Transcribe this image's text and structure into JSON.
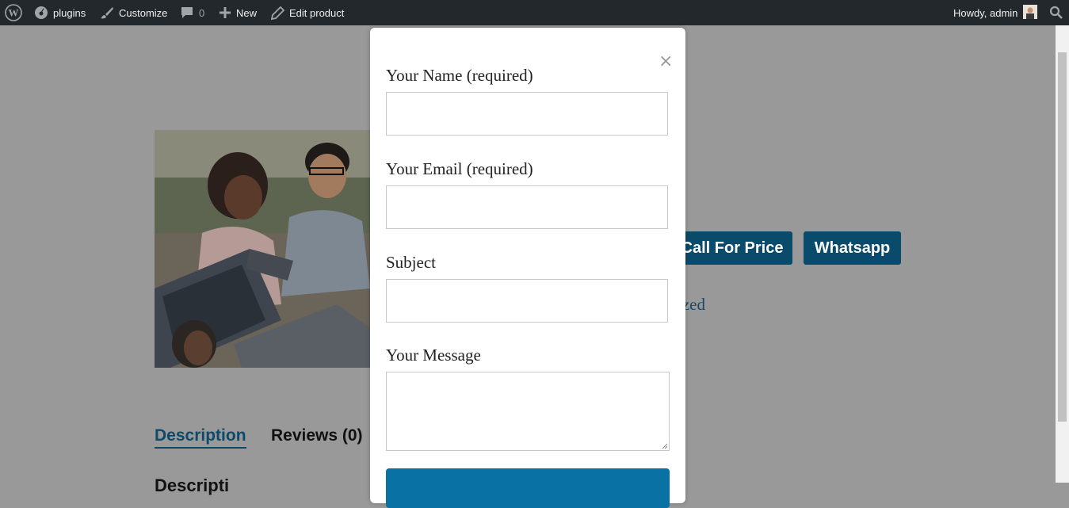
{
  "adminbar": {
    "site_name": "plugins",
    "customize": "Customize",
    "comments_count": "0",
    "new": "New",
    "edit_product": "Edit product",
    "howdy": "Howdy, admin"
  },
  "product": {
    "buttons": {
      "call_for_price": "Call For Price",
      "whatsapp": "Whatsapp"
    },
    "category_fragment": "rized",
    "tabs": {
      "description": "Description",
      "reviews": "Reviews (0)"
    },
    "description_heading": "Descripti"
  },
  "modal": {
    "fields": {
      "name_label": "Your Name (required)",
      "email_label": "Your Email (required)",
      "subject_label": "Subject",
      "message_label": "Your Message"
    }
  },
  "colors": {
    "adminbar_bg": "#23282d",
    "overlay": "#999999",
    "accent": "#0a71a5",
    "button_dimmed": "#0a4a6a"
  }
}
